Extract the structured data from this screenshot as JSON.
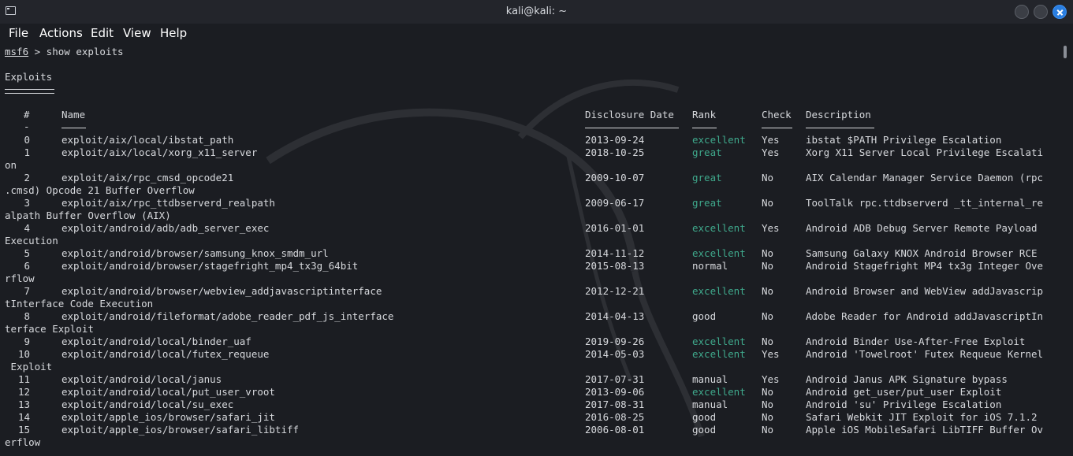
{
  "window": {
    "title": "kali@kali: ~"
  },
  "menu": [
    "File",
    "Actions",
    "Edit",
    "View",
    "Help"
  ],
  "prompt": {
    "module": "msf6",
    "rest": " > show exploits"
  },
  "section": {
    "title": "Exploits"
  },
  "headers": {
    "num": "#",
    "name": "Name",
    "date": "Disclosure Date",
    "rank": "Rank",
    "check": "Check",
    "desc": "Description"
  },
  "header_underlines": {
    "num": "-",
    "name": "────",
    "date": "───────────────",
    "rank": "────",
    "check": "─────",
    "desc": "───────────"
  },
  "rows": [
    {
      "num": "0",
      "name": "exploit/aix/local/ibstat_path",
      "date": "2013-09-24",
      "rank": "excellent",
      "check": "Yes",
      "desc": "ibstat $PATH Privilege Escalation",
      "wrap": ""
    },
    {
      "num": "1",
      "name": "exploit/aix/local/xorg_x11_server",
      "date": "2018-10-25",
      "rank": "great",
      "check": "Yes",
      "desc": "Xorg X11 Server Local Privilege Escalati",
      "wrap": "on"
    },
    {
      "num": "2",
      "name": "exploit/aix/rpc_cmsd_opcode21",
      "date": "2009-10-07",
      "rank": "great",
      "check": "No",
      "desc": "AIX Calendar Manager Service Daemon (rpc",
      "wrap": ".cmsd) Opcode 21 Buffer Overflow"
    },
    {
      "num": "3",
      "name": "exploit/aix/rpc_ttdbserverd_realpath",
      "date": "2009-06-17",
      "rank": "great",
      "check": "No",
      "desc": "ToolTalk rpc.ttdbserverd _tt_internal_re",
      "wrap": "alpath Buffer Overflow (AIX)"
    },
    {
      "num": "4",
      "name": "exploit/android/adb/adb_server_exec",
      "date": "2016-01-01",
      "rank": "excellent",
      "check": "Yes",
      "desc": "Android ADB Debug Server Remote Payload",
      "wrap": "Execution"
    },
    {
      "num": "5",
      "name": "exploit/android/browser/samsung_knox_smdm_url",
      "date": "2014-11-12",
      "rank": "excellent",
      "check": "No",
      "desc": "Samsung Galaxy KNOX Android Browser RCE",
      "wrap": ""
    },
    {
      "num": "6",
      "name": "exploit/android/browser/stagefright_mp4_tx3g_64bit",
      "date": "2015-08-13",
      "rank": "normal",
      "check": "No",
      "desc": "Android Stagefright MP4 tx3g Integer Ove",
      "wrap": "rflow"
    },
    {
      "num": "7",
      "name": "exploit/android/browser/webview_addjavascriptinterface",
      "date": "2012-12-21",
      "rank": "excellent",
      "check": "No",
      "desc": "Android Browser and WebView addJavascrip",
      "wrap": "tInterface Code Execution"
    },
    {
      "num": "8",
      "name": "exploit/android/fileformat/adobe_reader_pdf_js_interface",
      "date": "2014-04-13",
      "rank": "good",
      "check": "No",
      "desc": "Adobe Reader for Android addJavascriptIn",
      "wrap": "terface Exploit"
    },
    {
      "num": "9",
      "name": "exploit/android/local/binder_uaf",
      "date": "2019-09-26",
      "rank": "excellent",
      "check": "No",
      "desc": "Android Binder Use-After-Free Exploit",
      "wrap": ""
    },
    {
      "num": "10",
      "name": "exploit/android/local/futex_requeue",
      "date": "2014-05-03",
      "rank": "excellent",
      "check": "Yes",
      "desc": "Android 'Towelroot' Futex Requeue Kernel",
      "wrap": " Exploit"
    },
    {
      "num": "11",
      "name": "exploit/android/local/janus",
      "date": "2017-07-31",
      "rank": "manual",
      "check": "Yes",
      "desc": "Android Janus APK Signature bypass",
      "wrap": ""
    },
    {
      "num": "12",
      "name": "exploit/android/local/put_user_vroot",
      "date": "2013-09-06",
      "rank": "excellent",
      "check": "No",
      "desc": "Android get_user/put_user Exploit",
      "wrap": ""
    },
    {
      "num": "13",
      "name": "exploit/android/local/su_exec",
      "date": "2017-08-31",
      "rank": "manual",
      "check": "No",
      "desc": "Android 'su' Privilege Escalation",
      "wrap": ""
    },
    {
      "num": "14",
      "name": "exploit/apple_ios/browser/safari_jit",
      "date": "2016-08-25",
      "rank": "good",
      "check": "No",
      "desc": "Safari Webkit JIT Exploit for iOS 7.1.2",
      "wrap": ""
    },
    {
      "num": "15",
      "name": "exploit/apple_ios/browser/safari_libtiff",
      "date": "2006-08-01",
      "rank": "good",
      "check": "No",
      "desc": "Apple iOS MobileSafari LibTIFF Buffer Ov",
      "wrap": "erflow"
    }
  ],
  "colors": {
    "background": "#1b1d22",
    "titlebar": "#23252b",
    "text": "#d7d9dd",
    "rank_good_green": "#3fa98c",
    "close_button": "#2a7ee0"
  }
}
